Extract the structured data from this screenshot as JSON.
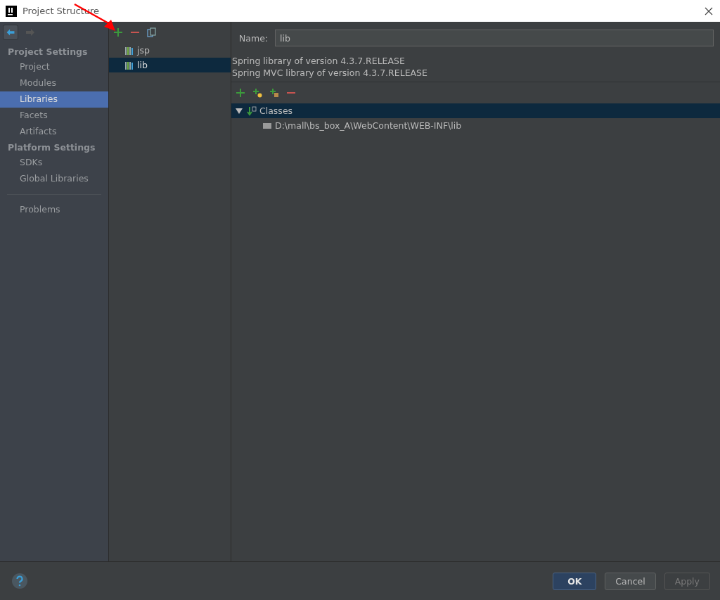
{
  "window": {
    "title": "Project Structure"
  },
  "sidebar": {
    "sections": [
      {
        "heading": "Project Settings",
        "items": [
          {
            "label": "Project",
            "selected": false
          },
          {
            "label": "Modules",
            "selected": false
          },
          {
            "label": "Libraries",
            "selected": true
          },
          {
            "label": "Facets",
            "selected": false
          },
          {
            "label": "Artifacts",
            "selected": false
          }
        ]
      },
      {
        "heading": "Platform Settings",
        "items": [
          {
            "label": "SDKs",
            "selected": false
          },
          {
            "label": "Global Libraries",
            "selected": false
          }
        ]
      }
    ],
    "extra_items": [
      {
        "label": "Problems",
        "selected": false
      }
    ]
  },
  "nav": {
    "back_disabled": false,
    "forward_disabled": true
  },
  "libraries": [
    {
      "label": "jsp",
      "selected": false
    },
    {
      "label": "lib",
      "selected": true
    }
  ],
  "details": {
    "name_label": "Name:",
    "name_value": "lib",
    "descriptions": [
      "Spring library of version 4.3.7.RELEASE",
      "Spring MVC library of version 4.3.7.RELEASE"
    ],
    "tree": [
      {
        "label": "Classes",
        "expanded": true,
        "selected": true,
        "children": [
          {
            "label": "D:\\mall\\bs_box_A\\WebContent\\WEB-INF\\lib",
            "selected": false
          }
        ]
      }
    ]
  },
  "buttons": [
    {
      "label": "OK",
      "kind": "primary",
      "disabled": false
    },
    {
      "label": "Cancel",
      "kind": "normal",
      "disabled": false
    },
    {
      "label": "Apply",
      "kind": "normal",
      "disabled": true
    }
  ]
}
